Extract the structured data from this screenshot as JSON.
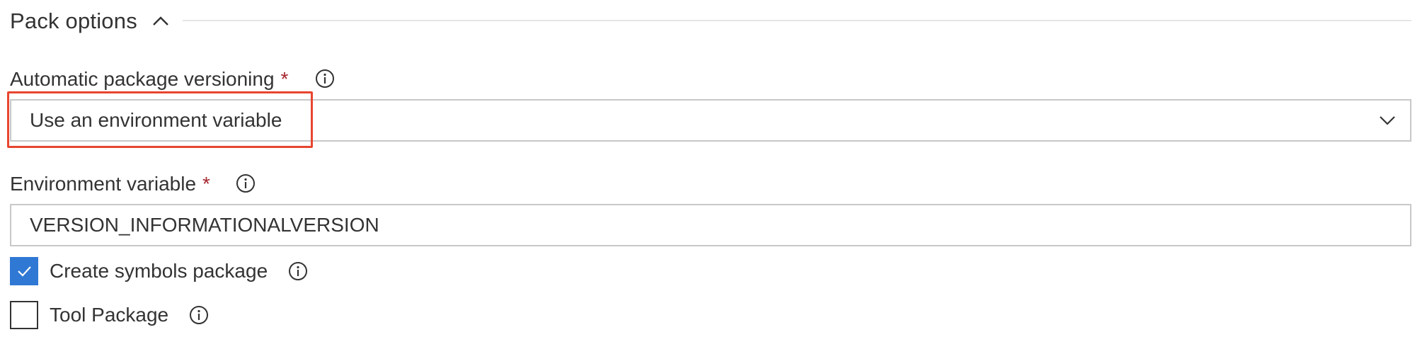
{
  "section": {
    "title": "Pack options",
    "toggle_icon": "chevron-up-icon"
  },
  "versioning": {
    "label": "Automatic package versioning",
    "required_mark": "*",
    "info_icon": "info-icon",
    "selected_value": "Use an environment variable",
    "dropdown_icon": "chevron-down-icon",
    "highlight_color": "#e8452f"
  },
  "environment_variable": {
    "label": "Environment variable",
    "required_mark": "*",
    "info_icon": "info-icon",
    "value": "VERSION_INFORMATIONALVERSION"
  },
  "options": [
    {
      "label": "Create symbols package",
      "checked": true,
      "info_icon": "info-icon"
    },
    {
      "label": "Tool Package",
      "checked": false,
      "info_icon": "info-icon"
    }
  ],
  "colors": {
    "accent": "#2f78d4",
    "required": "#a4262c",
    "text": "#333333",
    "border": "#c8c8c8"
  }
}
